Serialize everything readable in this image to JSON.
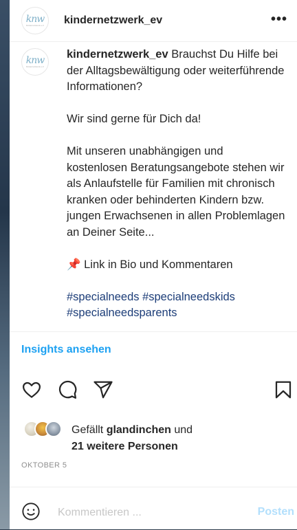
{
  "post": {
    "username": "kindernetzwerk_ev",
    "more_label": "•••"
  },
  "brand": {
    "logo_text": "knw",
    "logo_subtext": "Kindernetzwerk e.V."
  },
  "caption": {
    "username": "kindernetzwerk_ev",
    "text": " Brauchst Du Hilfe bei der Alltagsbewältigung oder weiterführende Informationen?\n\nWir sind gerne für Dich da!\n\nMit unseren unabhängigen und kostenlosen Beratungsangebote stehen wir als Anlaufstelle für Familien mit chronisch kranken oder behinderten Kindern bzw. jungen Erwachsenen in allen Problemlagen an Deiner Seite...\n\n📌 Link in Bio und Kommentaren\n\n",
    "hashtags": "#specialneeds #specialneedskids #specialneedsparents"
  },
  "insights_label": "Insights ansehen",
  "likes": {
    "prefix": "Gefällt ",
    "user": "glandinchen",
    "middle": " und",
    "others": "21 weitere Personen"
  },
  "date": "OKTOBER 5",
  "comment": {
    "placeholder": "Kommentieren ...",
    "post_label": "Posten"
  },
  "icons": [
    "heart-icon",
    "comment-icon",
    "share-icon",
    "bookmark-icon",
    "emoji-icon",
    "more-icon"
  ],
  "colors": {
    "insights": "#1da1f2",
    "hashtag": "#1c3d78",
    "post_button": "#b2dffc",
    "muted": "#8e8e8e"
  }
}
